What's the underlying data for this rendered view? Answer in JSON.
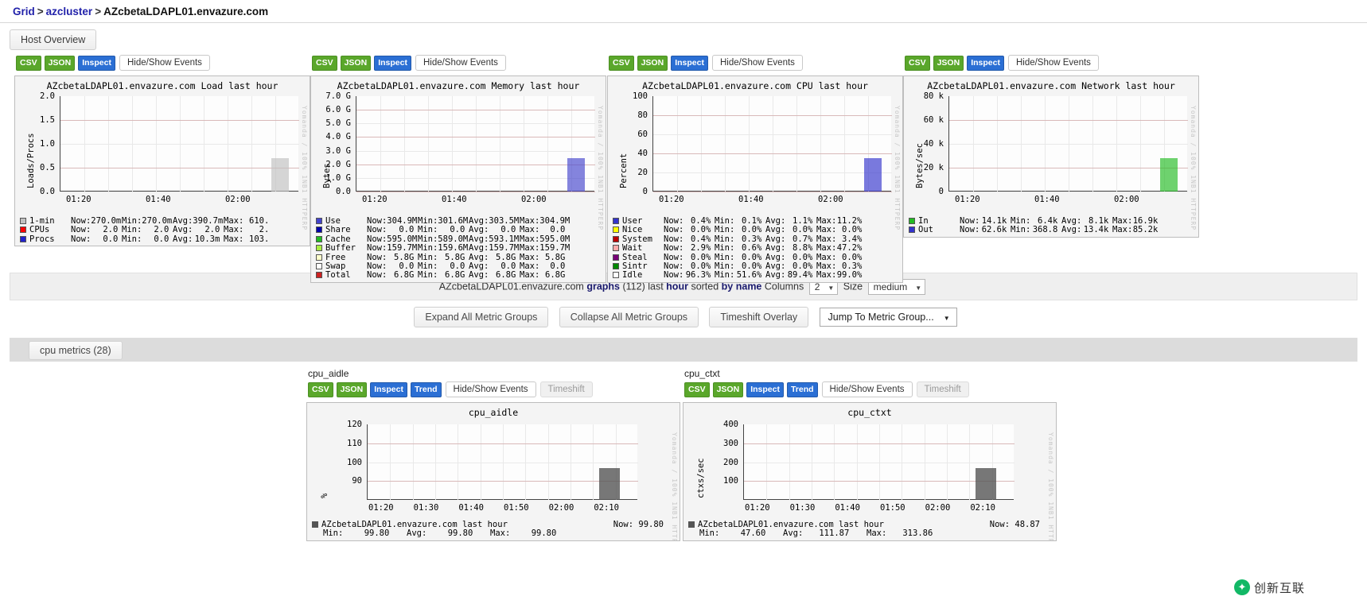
{
  "breadcrumb": {
    "grid": "Grid",
    "cluster": "azcluster",
    "host": "AZcbetaLDAPL01.envazure.com",
    "sep": ">"
  },
  "host_overview_button": "Host Overview",
  "buttons": {
    "csv": "CSV",
    "json": "JSON",
    "inspect": "Inspect",
    "trend": "Trend",
    "hide_show_events": "Hide/Show Events",
    "timeshift": "Timeshift"
  },
  "overview_panels": [
    {
      "title": "AZcbetaLDAPL01.envazure.com Load last hour",
      "watermark": "Yomanda / 100% 1NB1 HTTPERP",
      "chart_data": {
        "type": "line",
        "title": "AZcbetaLDAPL01.envazure.com Load last hour",
        "ylabel": "Loads/Procs",
        "xlabel": "",
        "ylim": [
          0.0,
          2.0
        ],
        "yticks": [
          "2.0",
          "1.5",
          "1.0",
          "0.5",
          "0.0"
        ],
        "xticks": [
          "01:20",
          "01:40",
          "02:00"
        ],
        "grid": true,
        "series": [
          {
            "name": "1-min",
            "color": "#c0c0c0",
            "now": "270.0m",
            "min": "270.0m",
            "avg": "390.7m",
            "max": "610."
          },
          {
            "name": "CPUs",
            "color": "#ff0000",
            "now": "2.0",
            "min": "2.0",
            "avg": "2.0",
            "max": "2."
          },
          {
            "name": "Procs",
            "color": "#2222cc",
            "now": "0.0",
            "min": "0.0",
            "avg": "10.3m",
            "max": "103."
          }
        ]
      },
      "legend": [
        {
          "swatch": "#c0c0c0",
          "name": "1-min",
          "now_label": "Now:",
          "now": "270.0m",
          "min_label": "Min:",
          "min": "270.0m",
          "avg_label": "Avg:",
          "avg": "390.7m",
          "max_label": "Max:",
          "max": "610."
        },
        {
          "swatch": "#ff0000",
          "name": "CPUs",
          "now_label": "Now:",
          "now": "2.0",
          "min_label": "Min:",
          "min": "2.0",
          "avg_label": "Avg:",
          "avg": "2.0",
          "max_label": "Max:",
          "max": "2."
        },
        {
          "swatch": "#2222cc",
          "name": "Procs",
          "now_label": "Now:",
          "now": "0.0",
          "min_label": "Min:",
          "min": "0.0",
          "avg_label": "Avg:",
          "avg": "10.3m",
          "max_label": "Max:",
          "max": "103."
        }
      ]
    },
    {
      "title": "AZcbetaLDAPL01.envazure.com Memory last hour",
      "watermark": "Yomanda / 100% 1NB1 HTTPERP",
      "chart_data": {
        "type": "area",
        "title": "AZcbetaLDAPL01.envazure.com Memory last hour",
        "ylabel": "Bytes",
        "xlabel": "",
        "ylim": [
          0.0,
          7.0
        ],
        "yticks": [
          "7.0 G",
          "6.0 G",
          "5.0 G",
          "4.0 G",
          "3.0 G",
          "2.0 G",
          "1.0 G",
          "0.0"
        ],
        "xticks": [
          "01:20",
          "01:40",
          "02:00"
        ],
        "grid": true,
        "series": [
          {
            "name": "Use",
            "color": "#4444cc",
            "now": "304.9M",
            "min": "301.6M",
            "avg": "303.5M",
            "max": "304.9M"
          },
          {
            "name": "Share",
            "color": "#0000aa",
            "now": "0.0",
            "min": "0.0",
            "avg": "0.0",
            "max": "0.0"
          },
          {
            "name": "Cache",
            "color": "#22bb22",
            "now": "595.0M",
            "min": "589.0M",
            "avg": "593.1M",
            "max": "595.0M"
          },
          {
            "name": "Buffer",
            "color": "#aaee44",
            "now": "159.7M",
            "min": "159.6M",
            "avg": "159.7M",
            "max": "159.7M"
          },
          {
            "name": "Free",
            "color": "#ffffcc",
            "now": "5.8G",
            "min": "5.8G",
            "avg": "5.8G",
            "max": "5.8G"
          },
          {
            "name": "Swap",
            "color": "#ffffff",
            "now": "0.0",
            "min": "0.0",
            "avg": "0.0",
            "max": "0.0"
          },
          {
            "name": "Total",
            "color": "#cc2222",
            "now": "6.8G",
            "min": "6.8G",
            "avg": "6.8G",
            "max": "6.8G"
          }
        ]
      },
      "legend": [
        {
          "swatch": "#4444cc",
          "name": "Use",
          "now_label": "Now:",
          "now": "304.9M",
          "min_label": "Min:",
          "min": "301.6M",
          "avg_label": "Avg:",
          "avg": "303.5M",
          "max_label": "Max:",
          "max": "304.9M"
        },
        {
          "swatch": "#0000aa",
          "name": "Share",
          "now_label": "Now:",
          "now": "0.0",
          "min_label": "Min:",
          "min": "0.0",
          "avg_label": "Avg:",
          "avg": "0.0",
          "max_label": "Max:",
          "max": "0.0"
        },
        {
          "swatch": "#22bb22",
          "name": "Cache",
          "now_label": "Now:",
          "now": "595.0M",
          "min_label": "Min:",
          "min": "589.0M",
          "avg_label": "Avg:",
          "avg": "593.1M",
          "max_label": "Max:",
          "max": "595.0M"
        },
        {
          "swatch": "#aaee44",
          "name": "Buffer",
          "now_label": "Now:",
          "now": "159.7M",
          "min_label": "Min:",
          "min": "159.6M",
          "avg_label": "Avg:",
          "avg": "159.7M",
          "max_label": "Max:",
          "max": "159.7M"
        },
        {
          "swatch": "#ffffcc",
          "name": "Free",
          "now_label": "Now:",
          "now": "5.8G",
          "min_label": "Min:",
          "min": "5.8G",
          "avg_label": "Avg:",
          "avg": "5.8G",
          "max_label": "Max:",
          "max": "5.8G"
        },
        {
          "swatch": "#ffffff",
          "name": "Swap",
          "now_label": "Now:",
          "now": "0.0",
          "min_label": "Min:",
          "min": "0.0",
          "avg_label": "Avg:",
          "avg": "0.0",
          "max_label": "Max:",
          "max": "0.0"
        },
        {
          "swatch": "#cc2222",
          "name": "Total",
          "now_label": "Now:",
          "now": "6.8G",
          "min_label": "Min:",
          "min": "6.8G",
          "avg_label": "Avg:",
          "avg": "6.8G",
          "max_label": "Max:",
          "max": "6.8G"
        }
      ]
    },
    {
      "title": "AZcbetaLDAPL01.envazure.com CPU last hour",
      "watermark": "Yomanda / 100% 1NB1 HTTPERP",
      "chart_data": {
        "type": "area",
        "title": "AZcbetaLDAPL01.envazure.com CPU last hour",
        "ylabel": "Percent",
        "xlabel": "",
        "ylim": [
          0,
          100
        ],
        "yticks": [
          "100",
          "80",
          "60",
          "40",
          "20",
          "0"
        ],
        "xticks": [
          "01:20",
          "01:40",
          "02:00"
        ],
        "grid": true,
        "series": [
          {
            "name": "User",
            "color": "#3333cc",
            "now": "0.4%",
            "min": "0.1%",
            "avg": "1.1%",
            "max": "11.2%"
          },
          {
            "name": "Nice",
            "color": "#ffff00",
            "now": "0.0%",
            "min": "0.0%",
            "avg": "0.0%",
            "max": "0.0%"
          },
          {
            "name": "System",
            "color": "#bb0000",
            "now": "0.4%",
            "min": "0.3%",
            "avg": "0.7%",
            "max": "3.4%"
          },
          {
            "name": "Wait",
            "color": "#ffaaaa",
            "now": "2.9%",
            "min": "0.6%",
            "avg": "8.8%",
            "max": "47.2%"
          },
          {
            "name": "Steal",
            "color": "#770077",
            "now": "0.0%",
            "min": "0.0%",
            "avg": "0.0%",
            "max": "0.0%"
          },
          {
            "name": "Sintr",
            "color": "#008800",
            "now": "0.0%",
            "min": "0.0%",
            "avg": "0.0%",
            "max": "0.3%"
          },
          {
            "name": "Idle",
            "color": "#ffffff",
            "now": "96.3%",
            "min": "51.6%",
            "avg": "89.4%",
            "max": "99.0%"
          }
        ]
      },
      "legend": [
        {
          "swatch": "#3333cc",
          "name": "User",
          "now_label": "Now:",
          "now": "0.4%",
          "min_label": "Min:",
          "min": "0.1%",
          "avg_label": "Avg:",
          "avg": "1.1%",
          "max_label": "Max:",
          "max": "11.2%"
        },
        {
          "swatch": "#ffff00",
          "name": "Nice",
          "now_label": "Now:",
          "now": "0.0%",
          "min_label": "Min:",
          "min": "0.0%",
          "avg_label": "Avg:",
          "avg": "0.0%",
          "max_label": "Max:",
          "max": "0.0%"
        },
        {
          "swatch": "#bb0000",
          "name": "System",
          "now_label": "Now:",
          "now": "0.4%",
          "min_label": "Min:",
          "min": "0.3%",
          "avg_label": "Avg:",
          "avg": "0.7%",
          "max_label": "Max:",
          "max": "3.4%"
        },
        {
          "swatch": "#ffaaaa",
          "name": "Wait",
          "now_label": "Now:",
          "now": "2.9%",
          "min_label": "Min:",
          "min": "0.6%",
          "avg_label": "Avg:",
          "avg": "8.8%",
          "max_label": "Max:",
          "max": "47.2%"
        },
        {
          "swatch": "#770077",
          "name": "Steal",
          "now_label": "Now:",
          "now": "0.0%",
          "min_label": "Min:",
          "min": "0.0%",
          "avg_label": "Avg:",
          "avg": "0.0%",
          "max_label": "Max:",
          "max": "0.0%"
        },
        {
          "swatch": "#008800",
          "name": "Sintr",
          "now_label": "Now:",
          "now": "0.0%",
          "min_label": "Min:",
          "min": "0.0%",
          "avg_label": "Avg:",
          "avg": "0.0%",
          "max_label": "Max:",
          "max": "0.3%"
        },
        {
          "swatch": "#ffffff",
          "name": "Idle",
          "now_label": "Now:",
          "now": "96.3%",
          "min_label": "Min:",
          "min": "51.6%",
          "avg_label": "Avg:",
          "avg": "89.4%",
          "max_label": "Max:",
          "max": "99.0%"
        }
      ]
    },
    {
      "title": "AZcbetaLDAPL01.envazure.com Network last hour",
      "watermark": "Yomanda / 100% 1NB1 HTTPERP",
      "chart_data": {
        "type": "line",
        "title": "AZcbetaLDAPL01.envazure.com Network last hour",
        "ylabel": "Bytes/sec",
        "xlabel": "",
        "ylim": [
          0,
          90000
        ],
        "yticks": [
          "80 k",
          "60 k",
          "40 k",
          "20 k",
          "0"
        ],
        "xticks": [
          "01:20",
          "01:40",
          "02:00"
        ],
        "grid": true,
        "series": [
          {
            "name": "In",
            "color": "#22bb22",
            "now": "14.1k",
            "min": "6.4k",
            "avg": "8.1k",
            "max": "16.9k"
          },
          {
            "name": "Out",
            "color": "#3333cc",
            "now": "62.6k",
            "min": "368.8",
            "avg": "13.4k",
            "max": "85.2k"
          }
        ]
      },
      "legend": [
        {
          "swatch": "#22bb22",
          "name": "In",
          "now_label": "Now:",
          "now": "14.1k",
          "min_label": "Min:",
          "min": "6.4k",
          "avg_label": "Avg:",
          "avg": "8.1k",
          "max_label": "Max:",
          "max": "16.9k"
        },
        {
          "swatch": "#3333cc",
          "name": "Out",
          "now_label": "Now:",
          "now": "62.6k",
          "min_label": "Min:",
          "min": "368.8",
          "avg_label": "Avg:",
          "avg": "13.4k",
          "max_label": "Max:",
          "max": "85.2k"
        }
      ]
    }
  ],
  "controlbar": {
    "host": "AZcbetaLDAPL01.envazure.com",
    "graphs_word": "graphs",
    "count": "(112)",
    "last_word": "last",
    "range": "hour",
    "sorted_word": "sorted",
    "sort_by": "by name",
    "columns_label": "Columns",
    "columns_value": "2",
    "size_label": "Size",
    "size_value": "medium"
  },
  "group_controls": {
    "expand": "Expand All Metric Groups",
    "collapse": "Collapse All Metric Groups",
    "timeshift_overlay": "Timeshift Overlay",
    "jump": "Jump To Metric Group..."
  },
  "metric_group": {
    "tab_label": "cpu metrics (28)"
  },
  "metric_panels": [
    {
      "name": "cpu_aidle",
      "watermark": "Yomanda / 100% 1NB1 HTTPERP",
      "footer": {
        "host_line": "AZcbetaLDAPL01.envazure.com last hour",
        "min_label": "Min:",
        "min": "99.80",
        "avg_label": "Avg:",
        "avg": "99.80",
        "max_label": "Max:",
        "max": "99.80",
        "now_label": "Now:",
        "now": "99.80"
      },
      "chart_data": {
        "type": "line",
        "title": "cpu_aidle",
        "ylabel": "%",
        "xlabel": "",
        "ylim": [
          90,
          125
        ],
        "yticks": [
          "120",
          "110",
          "100",
          "90"
        ],
        "xticks": [
          "01:20",
          "01:30",
          "01:40",
          "01:50",
          "02:00",
          "02:10"
        ],
        "grid": true,
        "series": [
          {
            "name": "cpu_aidle",
            "color": "#555555",
            "now": "99.80",
            "min": "99.80",
            "avg": "99.80",
            "max": "99.80"
          }
        ]
      }
    },
    {
      "name": "cpu_ctxt",
      "watermark": "Yomanda / 100% 1NB1 HTTPERP",
      "footer": {
        "host_line": "AZcbetaLDAPL01.envazure.com last hour",
        "min_label": "Min:",
        "min": "47.60",
        "avg_label": "Avg:",
        "avg": "111.87",
        "max_label": "Max:",
        "max": "313.86",
        "now_label": "Now:",
        "now": "48.87"
      },
      "chart_data": {
        "type": "line",
        "title": "cpu_ctxt",
        "ylabel": "ctxs/sec",
        "xlabel": "",
        "ylim": [
          0,
          420
        ],
        "yticks": [
          "400",
          "300",
          "200",
          "100"
        ],
        "xticks": [
          "01:20",
          "01:30",
          "01:40",
          "01:50",
          "02:00",
          "02:10"
        ],
        "grid": true,
        "series": [
          {
            "name": "cpu_ctxt",
            "color": "#555555",
            "now": "48.87",
            "min": "47.60",
            "avg": "111.87",
            "max": "313.86"
          }
        ]
      }
    }
  ],
  "watermark_badge": {
    "icon": "leaf-icon",
    "text": "创新互联"
  }
}
